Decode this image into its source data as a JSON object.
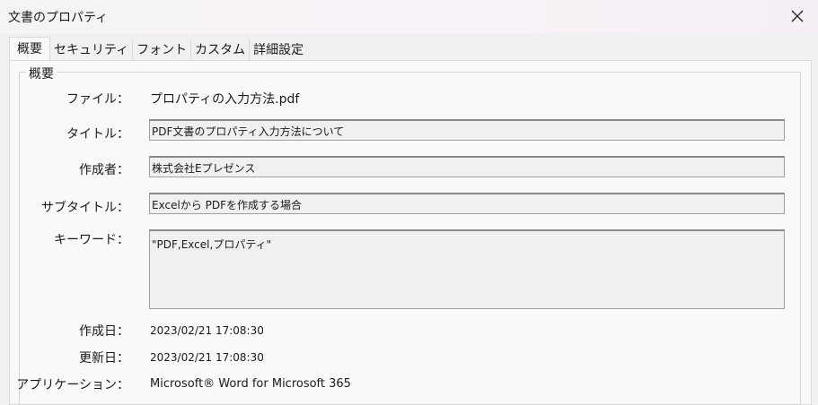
{
  "window": {
    "title": "文書のプロパティ"
  },
  "tabs": [
    {
      "label": "概要"
    },
    {
      "label": "セキュリティ"
    },
    {
      "label": "フォント"
    },
    {
      "label": "カスタム"
    },
    {
      "label": "詳細設定"
    }
  ],
  "group": {
    "legend": "概要"
  },
  "fields": {
    "file": {
      "label": "ファイル：",
      "value": "プロパティの入力方法.pdf"
    },
    "title": {
      "label": "タイトル：",
      "value": "PDF文書のプロパティ入力方法について"
    },
    "author": {
      "label": "作成者：",
      "value": "株式会社Eプレゼンス"
    },
    "subject": {
      "label": "サブタイトル：",
      "value": "Excelから PDFを作成する場合"
    },
    "keywords": {
      "label": "キーワード：",
      "value": "\"PDF,Excel,プロパティ\""
    },
    "created": {
      "label": "作成日：",
      "value": "2023/02/21 17:08:30"
    },
    "modified": {
      "label": "更新日：",
      "value": "2023/02/21 17:08:30"
    },
    "application": {
      "label": "アプリケーション：",
      "value": "Microsoft® Word for Microsoft 365"
    }
  }
}
